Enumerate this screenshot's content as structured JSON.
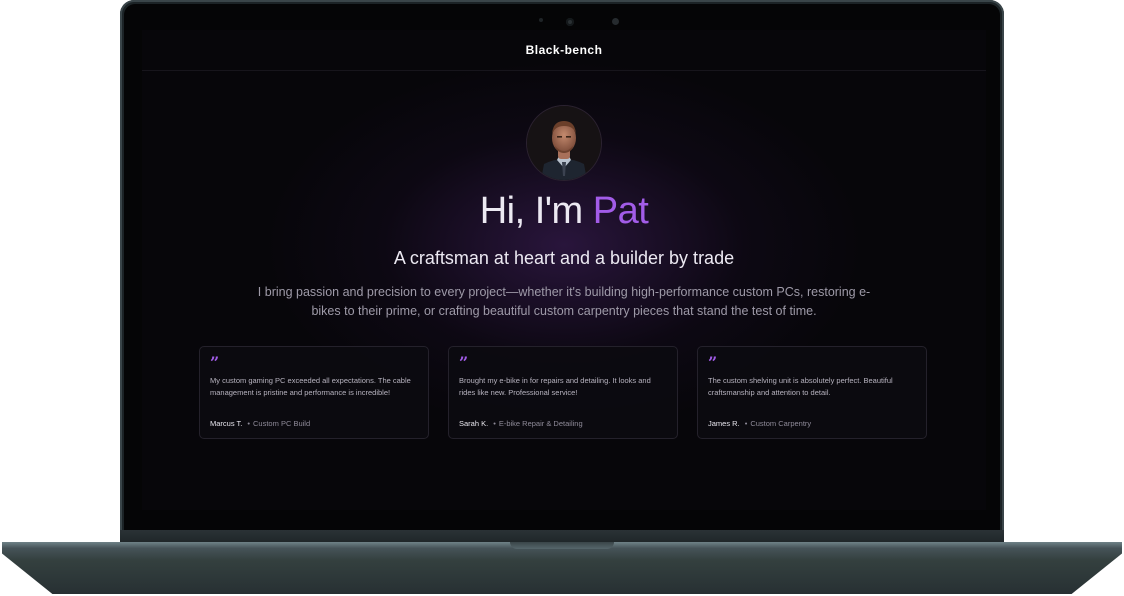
{
  "site": {
    "brand": "Black-bench"
  },
  "hero": {
    "greeting": "Hi, I'm ",
    "name": "Pat",
    "tagline": "A craftsman at heart and a builder by trade",
    "bio": "I bring passion and precision to every project—whether it's building high-performance custom PCs, restoring e-bikes to their prime, or crafting beautiful custom carpentry pieces that stand the test of time."
  },
  "testimonials": [
    {
      "quote": "My custom gaming PC exceeded all expectations. The cable management is pristine and performance is incredible!",
      "author": "Marcus T.",
      "service": "Custom PC Build"
    },
    {
      "quote": "Brought my e-bike in for repairs and detailing. It looks and rides like new. Professional service!",
      "author": "Sarah K.",
      "service": "E-bike Repair & Detailing"
    },
    {
      "quote": "The custom shelving unit is absolutely perfect. Beautiful craftsmanship and attention to detail.",
      "author": "James R.",
      "service": "Custom Carpentry"
    }
  ],
  "icons": {
    "quote": "quote-icon"
  },
  "colors": {
    "accent": "#a25ce8",
    "background": "#07060a",
    "laptop": "#1c2326"
  }
}
